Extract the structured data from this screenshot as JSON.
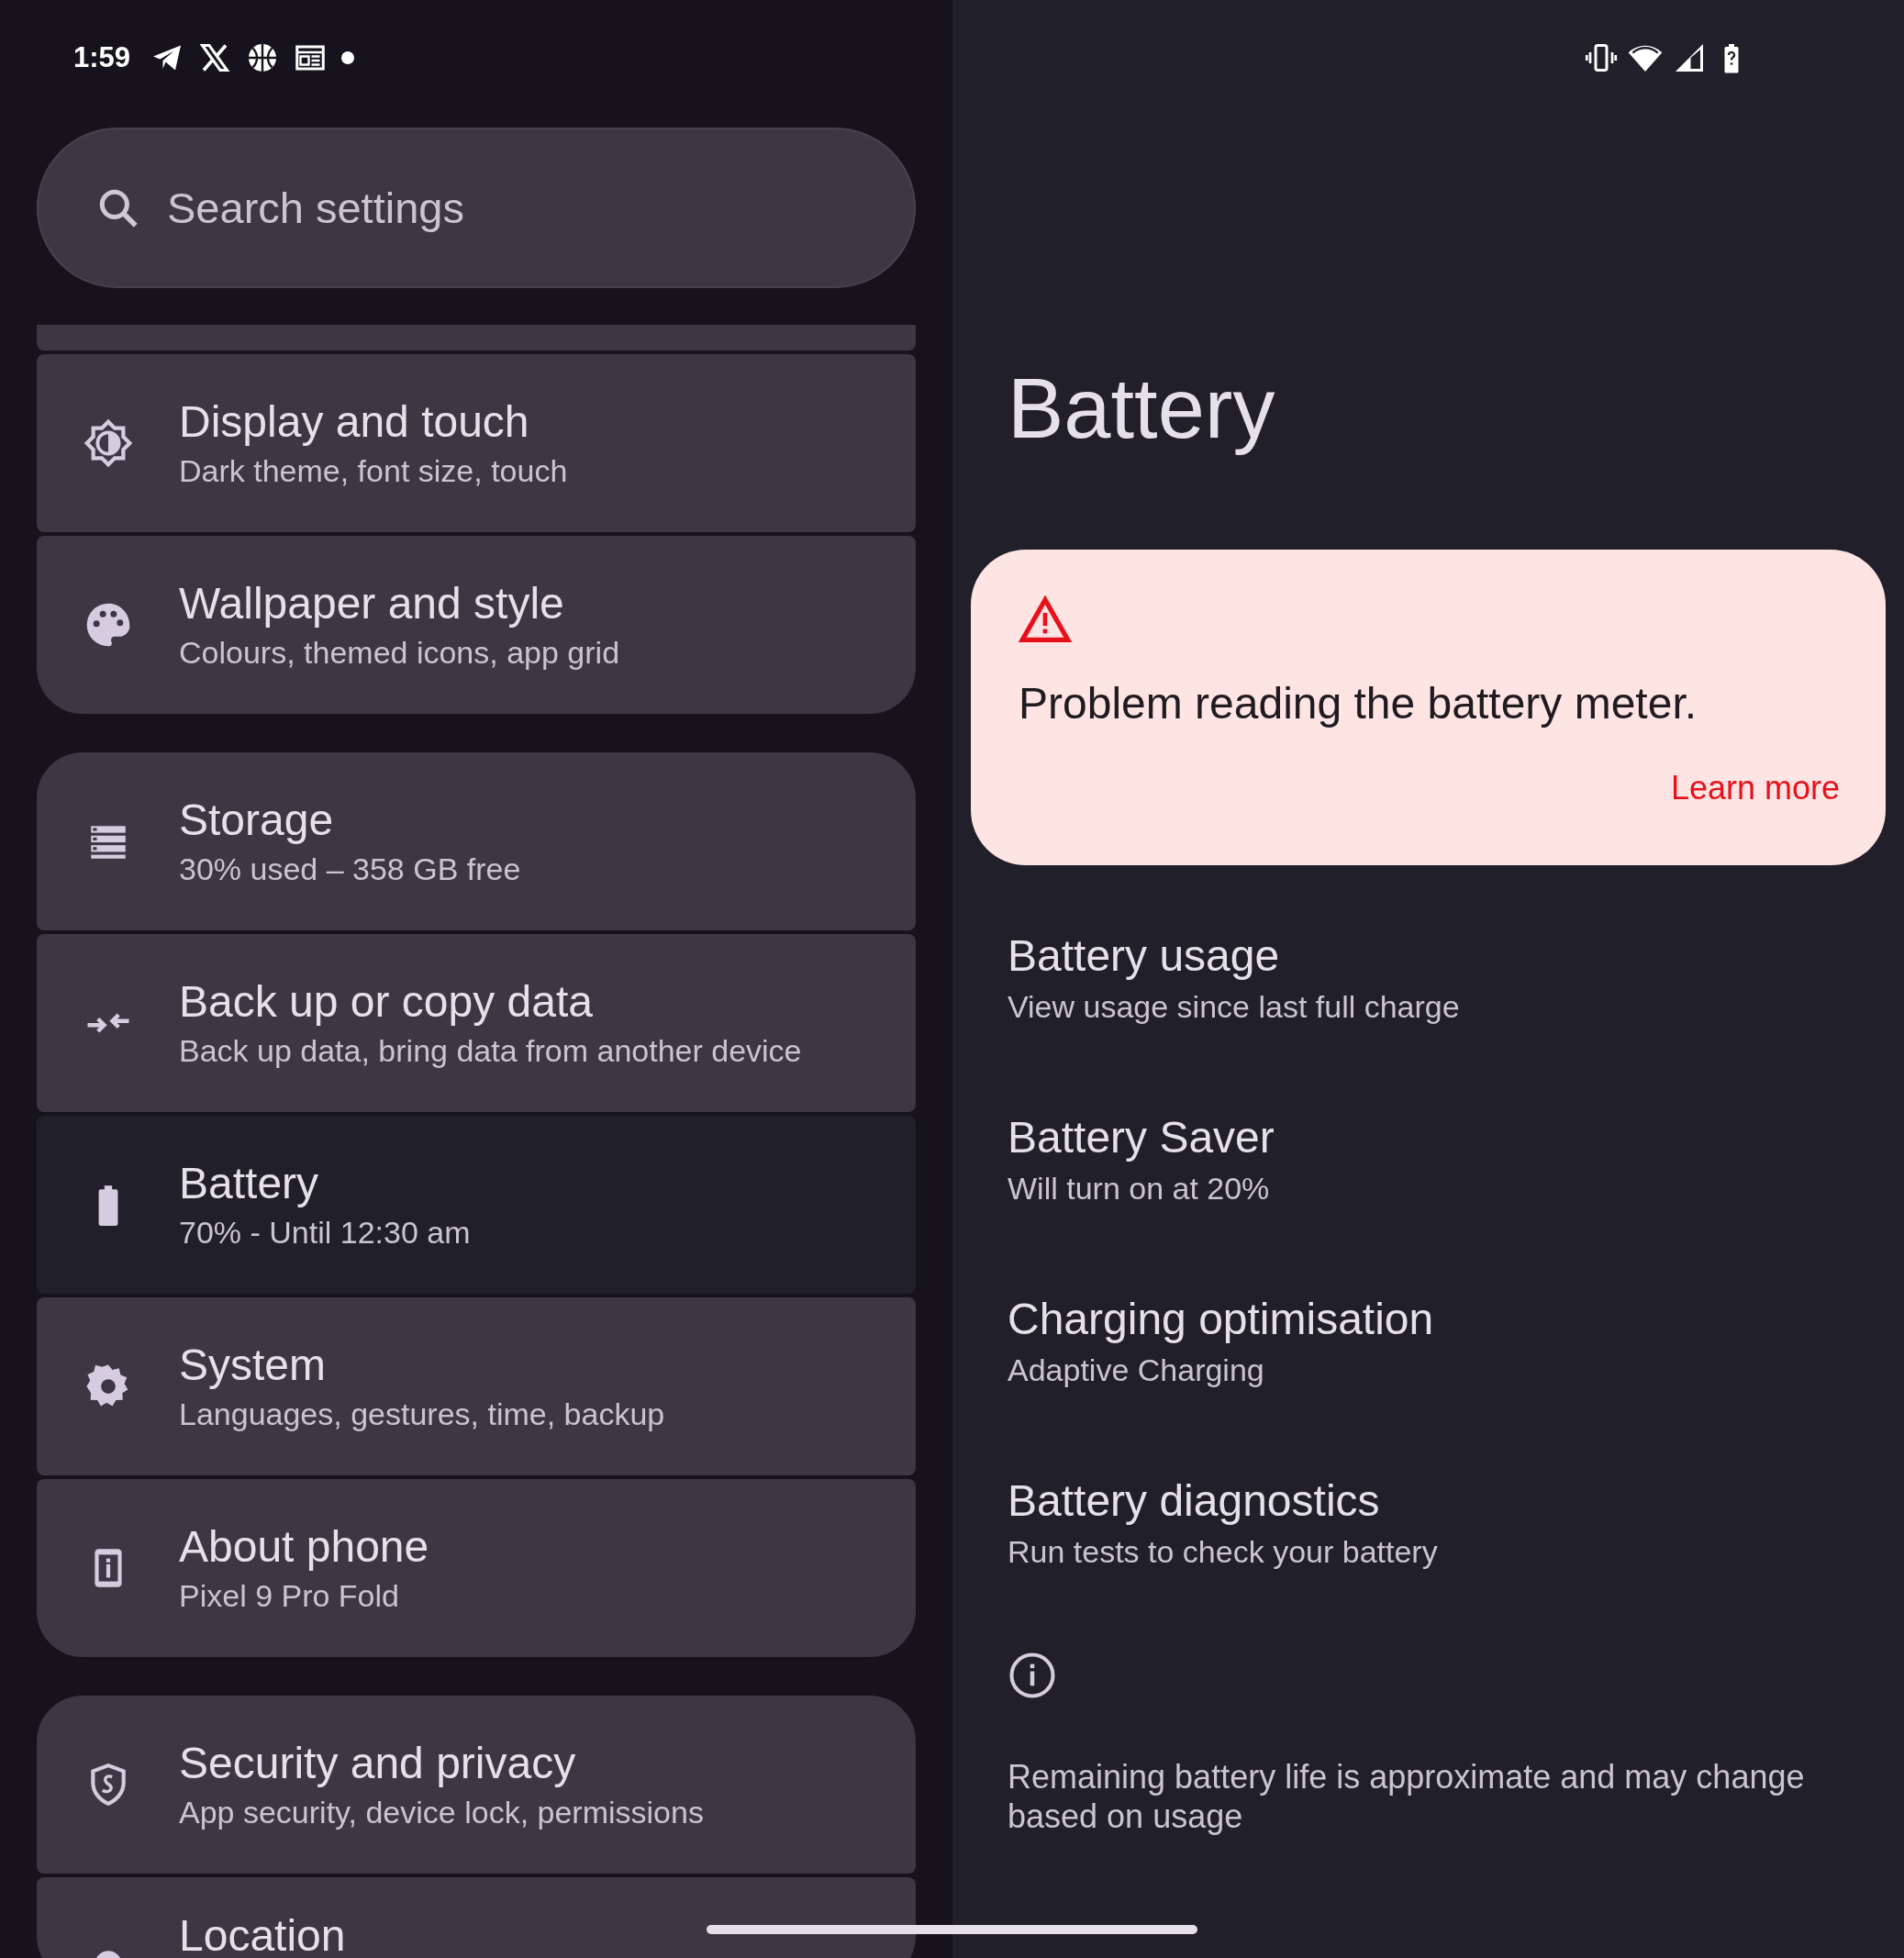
{
  "status_bar": {
    "time": "1:59"
  },
  "search": {
    "placeholder": "Search settings"
  },
  "settings_groups": [
    {
      "items": [
        {
          "title": "Display and touch",
          "summary": "Dark theme, font size, touch",
          "selected": false
        },
        {
          "title": "Wallpaper and style",
          "summary": "Colours, themed icons, app grid",
          "selected": false
        }
      ]
    },
    {
      "items": [
        {
          "title": "Storage",
          "summary": "30% used – 358 GB free",
          "selected": false
        },
        {
          "title": "Back up or copy data",
          "summary": "Back up data, bring data from another device",
          "selected": false
        },
        {
          "title": "Battery",
          "summary": "70% - Until 12:30 am",
          "selected": true
        },
        {
          "title": "System",
          "summary": "Languages, gestures, time, backup",
          "selected": false
        },
        {
          "title": "About phone",
          "summary": "Pixel 9 Pro Fold",
          "selected": false
        }
      ]
    },
    {
      "items": [
        {
          "title": "Security and privacy",
          "summary": "App security, device lock, permissions",
          "selected": false
        },
        {
          "title": "Location",
          "selected": false
        }
      ]
    }
  ],
  "detail": {
    "title": "Battery",
    "alert": {
      "message": "Problem reading the battery meter.",
      "link": "Learn more"
    },
    "items": [
      {
        "title": "Battery usage",
        "summary": "View usage since last full charge"
      },
      {
        "title": "Battery Saver",
        "summary": "Will turn on at 20%"
      },
      {
        "title": "Charging optimisation",
        "summary": "Adaptive Charging"
      },
      {
        "title": "Battery diagnostics",
        "summary": "Run tests to check your battery"
      }
    ],
    "footer": "Remaining battery life is approximate and may change based on usage"
  }
}
